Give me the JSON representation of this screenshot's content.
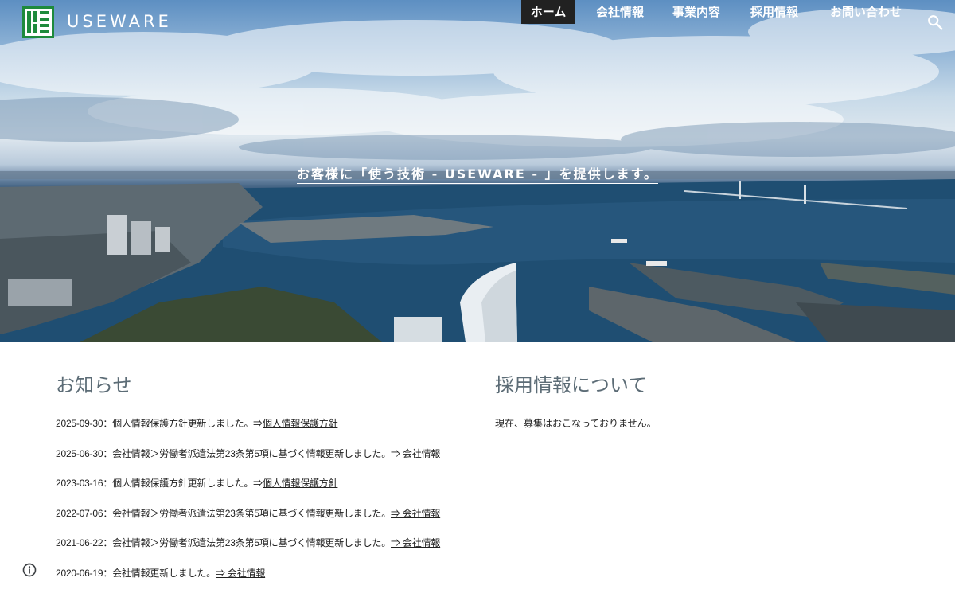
{
  "header": {
    "logo_text": "USEWARE",
    "logo_icon": "useware-logo-icon",
    "nav": [
      {
        "label": "ホーム",
        "active": true
      },
      {
        "label": "会社情報",
        "active": false
      },
      {
        "label": "事業内容",
        "active": false
      },
      {
        "label": "採用情報",
        "active": false
      },
      {
        "label": "お問い合わせ",
        "active": false
      }
    ],
    "search_icon": "search-icon"
  },
  "hero": {
    "tagline": "お客様に「使う技術 - USEWARE - 」を提供します。"
  },
  "news": {
    "title": "お知らせ",
    "items": [
      {
        "text": "2025-09-30：個人情報保護方針更新しました。⇒",
        "link": "個人情報保護方針"
      },
      {
        "text": "2025-06-30：会社情報＞労働者派遣法第23条第5項に基づく情報更新しました。",
        "link": "⇒ 会社情報"
      },
      {
        "text": "2023-03-16：個人情報保護方針更新しました。⇒",
        "link": "個人情報保護方針"
      },
      {
        "text": "2022-07-06：会社情報＞労働者派遣法第23条第5項に基づく情報更新しました。",
        "link": "⇒ 会社情報"
      },
      {
        "text": "2021-06-22：会社情報＞労働者派遣法第23条第5項に基づく情報更新しました。",
        "link": "⇒ 会社情報"
      },
      {
        "text": "2020-06-19：会社情報更新しました。",
        "link": "⇒ 会社情報"
      }
    ]
  },
  "recruit": {
    "title": "採用情報について",
    "text": "現在、募集はおこなっておりません。"
  },
  "footer": {
    "info_icon": "info-icon"
  },
  "colors": {
    "nav_active_bg": "#212121",
    "section_title": "#5c6c76",
    "logo_green": "#1e8a3c"
  }
}
